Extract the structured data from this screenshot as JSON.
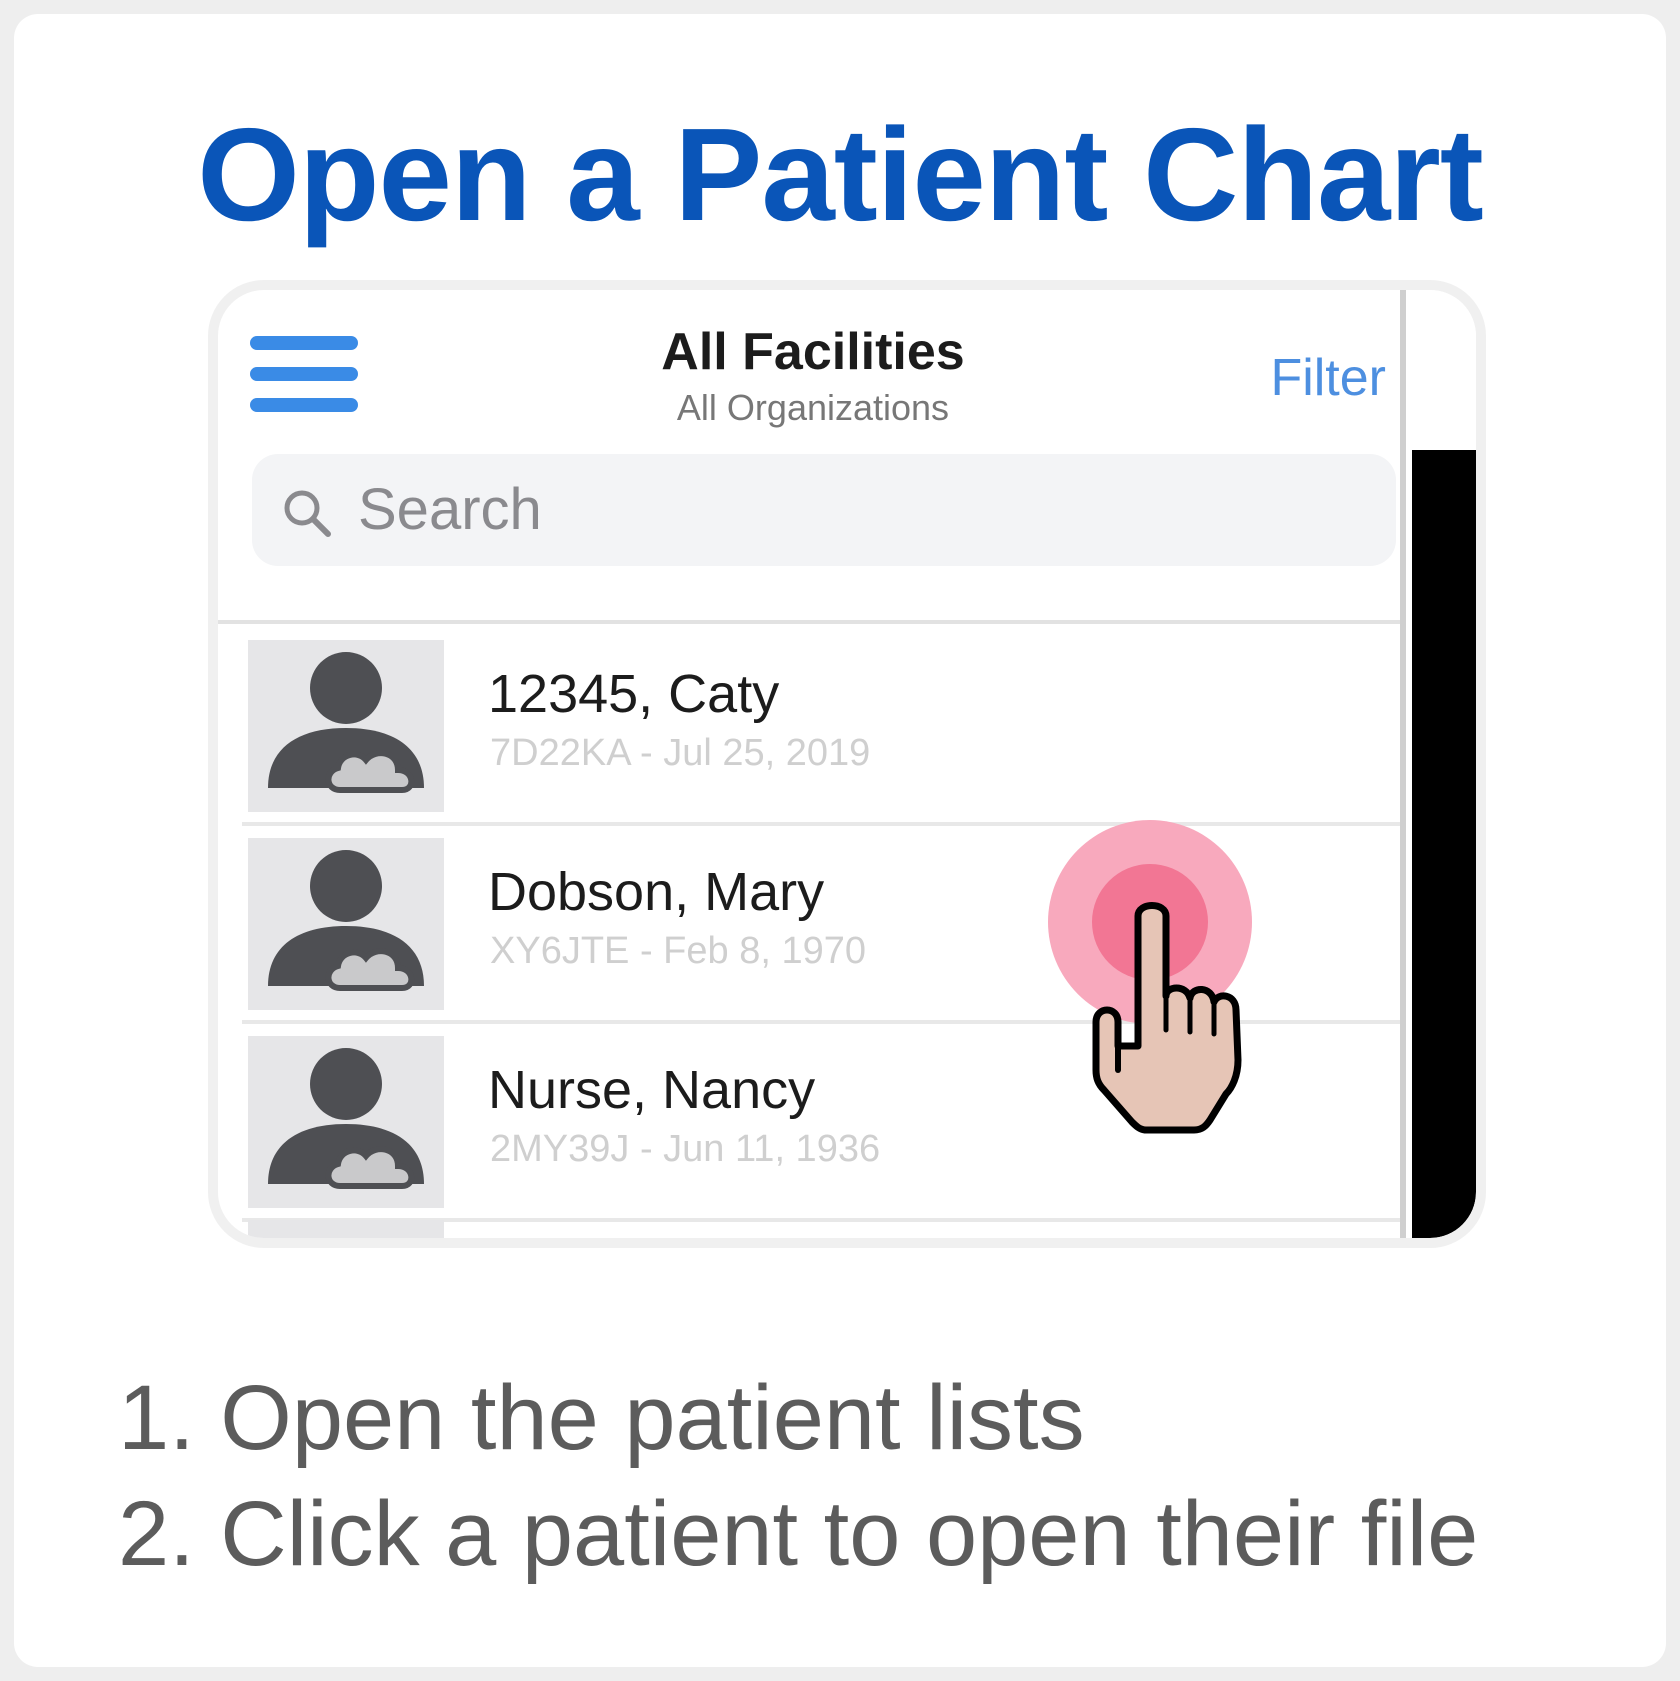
{
  "title": "Open a Patient Chart",
  "header": {
    "title": "All Facilities",
    "subtitle": "All Organizations",
    "filter_label": "Filter"
  },
  "search": {
    "placeholder": "Search"
  },
  "patients": [
    {
      "name": "12345, Caty",
      "details": "7D22KA - Jul 25, 2019"
    },
    {
      "name": "Dobson, Mary",
      "details": "XY6JTE - Feb 8, 1970"
    },
    {
      "name": "Nurse, Nancy",
      "details": "2MY39J - Jun 11, 1936"
    }
  ],
  "steps": [
    "1. Open the patient lists",
    "2. Click a patient to open their file"
  ],
  "colors": {
    "title": "#0a55b8",
    "menu_icon": "#3a8be6",
    "filter": "#4d8fe0",
    "tap_outer": "#f8a9bd",
    "tap_inner": "#f27694",
    "hand_fill": "#e6c5b6"
  },
  "icons": {
    "menu": "hamburger-menu-icon",
    "search": "magnifier-search-icon",
    "avatar": "person-cloud-avatar-icon",
    "tap": "pointing-hand-tap-icon"
  }
}
